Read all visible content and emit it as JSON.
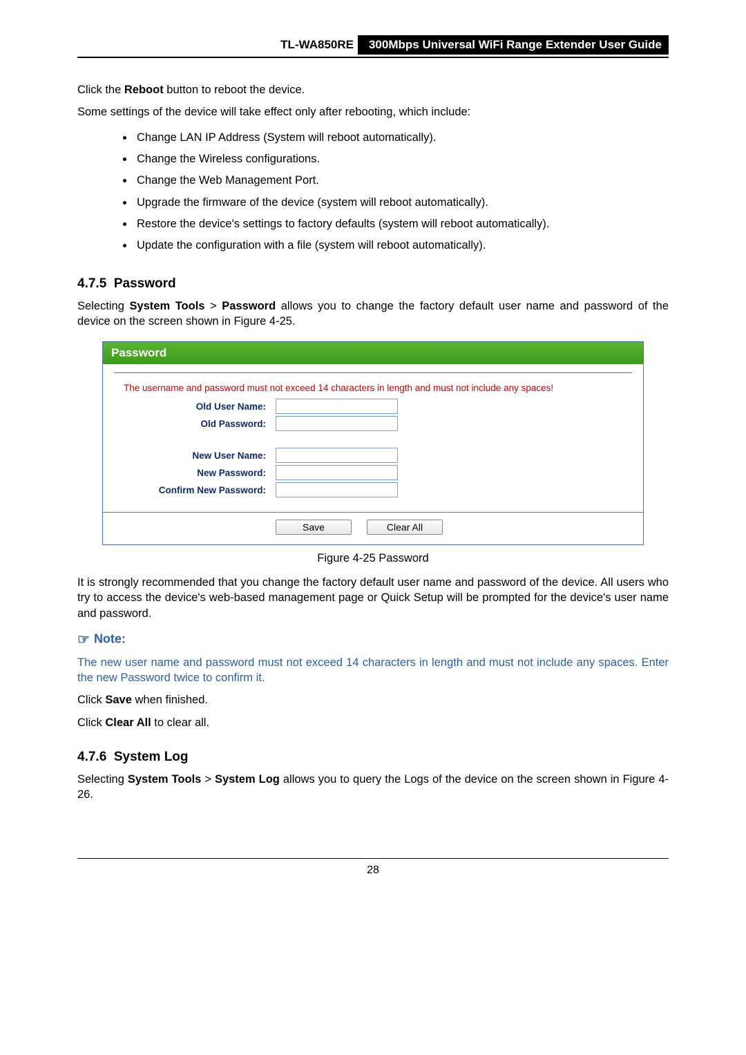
{
  "header": {
    "model": "TL-WA850RE",
    "title_black": "300Mbps Universal WiFi Range Extender User Guide"
  },
  "para_reboot": "Click the Reboot button to reboot the device.",
  "para_reboot_bold": "Reboot",
  "para_settings_intro": "Some settings of the device will take effect only after rebooting, which include:",
  "reboot_items": [
    "Change LAN IP Address (System will reboot automatically).",
    "Change the Wireless configurations.",
    "Change the Web Management Port.",
    "Upgrade the firmware of the device (system will reboot automatically).",
    "Restore the device's settings to factory defaults (system will reboot automatically).",
    "Update the configuration with a file (system will reboot automatically)."
  ],
  "sec_475_num": "4.7.5",
  "sec_475_title": "Password",
  "para_475_a": "Selecting ",
  "para_475_sys_tools": "System Tools",
  "para_475_gt": " > ",
  "para_475_password": "Password",
  "para_475_b": " allows you to change the factory default user name and password of the device on the screen shown in Figure 4-25.",
  "figure": {
    "panel_title": "Password",
    "warning": "The username and password must not exceed 14 characters in length and must not include any spaces!",
    "labels": {
      "old_user": "Old User Name:",
      "old_pass": "Old Password:",
      "new_user": "New User Name:",
      "new_pass": "New Password:",
      "confirm": "Confirm New Password:"
    },
    "buttons": {
      "save": "Save",
      "clear": "Clear All"
    },
    "caption": "Figure 4-25 Password"
  },
  "para_recommend": "It is strongly recommended that you change the factory default user name and password of the device. All users who try to access the device's web-based management page or Quick Setup will be prompted for the device's user name and password.",
  "note_label": "Note:",
  "note_text": "The new user name and password must not exceed 14 characters in length and must not include any spaces. Enter the new Password twice to confirm it.",
  "para_save_a": "Click ",
  "para_save_b": "Save",
  "para_save_c": " when finished.",
  "para_clear_a": "Click ",
  "para_clear_b": "Clear All",
  "para_clear_c": " to clear all.",
  "sec_476_num": "4.7.6",
  "sec_476_title": "System Log",
  "para_476_a": "Selecting ",
  "para_476_sys_tools": "System Tools",
  "para_476_gt": " > ",
  "para_476_syslog": "System Log",
  "para_476_b": " allows you to query the Logs of the device on the screen shown in Figure 4-26.",
  "page_number": "28"
}
